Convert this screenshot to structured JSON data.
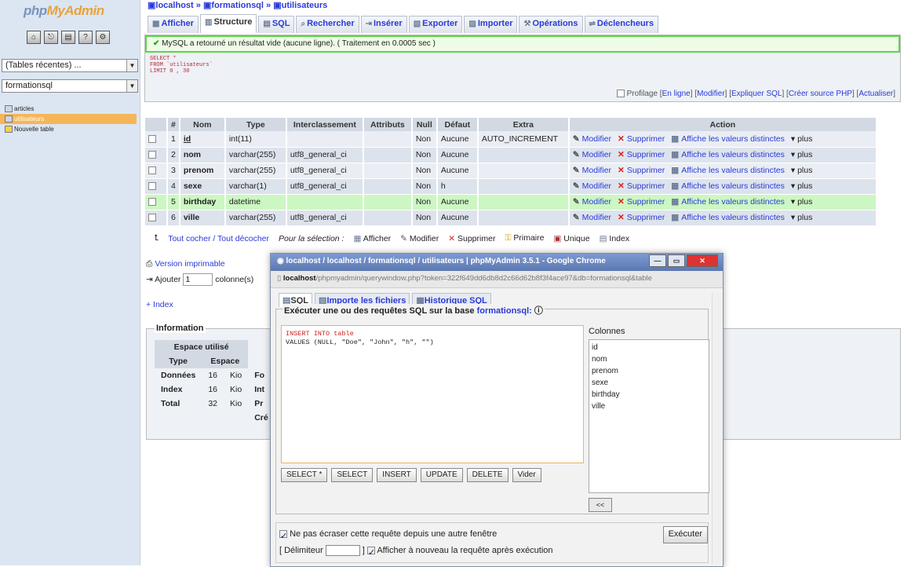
{
  "sidebar": {
    "logo_php": "php",
    "logo_myadmin": "MyAdmin",
    "icons": [
      "home-icon",
      "exit-icon",
      "query-window-icon",
      "docs-icon",
      "config-icon"
    ],
    "recent_tables": "(Tables récentes) ...",
    "database_select": "formationsql",
    "tables": [
      {
        "label": "articles",
        "selected": false
      },
      {
        "label": "utilisateurs",
        "selected": true
      },
      {
        "label": "Nouvelle table",
        "selected": false
      }
    ]
  },
  "breadcrumb": {
    "server": "localhost",
    "database": "formationsql",
    "table": "utilisateurs"
  },
  "tabs": [
    "Afficher",
    "Structure",
    "SQL",
    "Rechercher",
    "Insérer",
    "Exporter",
    "Importer",
    "Opérations",
    "Déclencheurs"
  ],
  "message": {
    "text": "MySQL a retourné un résultat vide (aucune ligne). ( Traitement en 0.0005 sec )",
    "sql_lines": [
      "SELECT *",
      "FROM `utilisateurs`",
      "LIMIT 0 , 30"
    ],
    "profiling_label": "Profilage",
    "links": [
      "En ligne",
      "Modifier",
      "Expliquer SQL",
      "Créer source PHP",
      "Actualiser"
    ]
  },
  "structure": {
    "headers": [
      "#",
      "Nom",
      "Type",
      "Interclassement",
      "Attributs",
      "Null",
      "Défaut",
      "Extra",
      "Action"
    ],
    "rows": [
      {
        "num": "1",
        "name": "id",
        "type": "int(11)",
        "collation": "",
        "attributes": "",
        "null": "Non",
        "default": "Aucune",
        "extra": "AUTO_INCREMENT"
      },
      {
        "num": "2",
        "name": "nom",
        "type": "varchar(255)",
        "collation": "utf8_general_ci",
        "attributes": "",
        "null": "Non",
        "default": "Aucune",
        "extra": ""
      },
      {
        "num": "3",
        "name": "prenom",
        "type": "varchar(255)",
        "collation": "utf8_general_ci",
        "attributes": "",
        "null": "Non",
        "default": "Aucune",
        "extra": ""
      },
      {
        "num": "4",
        "name": "sexe",
        "type": "varchar(1)",
        "collation": "utf8_general_ci",
        "attributes": "",
        "null": "Non",
        "default": "h",
        "extra": ""
      },
      {
        "num": "5",
        "name": "birthday",
        "type": "datetime",
        "collation": "",
        "attributes": "",
        "null": "Non",
        "default": "Aucune",
        "extra": ""
      },
      {
        "num": "6",
        "name": "ville",
        "type": "varchar(255)",
        "collation": "utf8_general_ci",
        "attributes": "",
        "null": "Non",
        "default": "Aucune",
        "extra": ""
      }
    ],
    "actions": {
      "modify": "Modifier",
      "delete": "Supprimer",
      "distinct": "Affiche les valeurs distinctes",
      "more": "plus"
    }
  },
  "bulk": {
    "check_all": "Tout cocher / Tout décocher",
    "with_selected": "Pour la sélection :",
    "actions": [
      "Afficher",
      "Modifier",
      "Supprimer",
      "Primaire",
      "Unique",
      "Index"
    ]
  },
  "below": {
    "print_view": "Version imprimable",
    "add_label": "Ajouter",
    "add_value": "1",
    "columns_label": "colonne(s)",
    "index_link": "+ Index"
  },
  "info": {
    "legend": "Information",
    "space_header": "Espace utilisé",
    "type_header": "Type",
    "space_col_header": "Espace",
    "rows": [
      {
        "type": "Données",
        "space": "16",
        "unit": "Kio"
      },
      {
        "type": "Index",
        "space": "16",
        "unit": "Kio"
      },
      {
        "type": "Total",
        "space": "32",
        "unit": "Kio"
      }
    ],
    "right_labels": [
      "Fo",
      "Int",
      "Pr",
      "Cré"
    ]
  },
  "popup": {
    "title": "localhost / localhost / formationsql / utilisateurs | phpMyAdmin 3.5.1 - Google Chrome",
    "url_host": "localhost",
    "url_rest": "/phpmyadmin/querywindow.php?token=322f649dd6db8d2c66d62b8f3f4ace97&db=formationsql&table",
    "tabs": [
      "SQL",
      "Importe les fichiers",
      "Historique SQL"
    ],
    "legend_prefix": "Exécuter une ou des requêtes SQL sur la base",
    "legend_db": "formationsql:",
    "sql_line1": "INSERT INTO table",
    "sql_line2": "VALUES (NULL, \"Doe\", \"John\", \"h\", \"\")",
    "buttons": [
      "SELECT *",
      "SELECT",
      "INSERT",
      "UPDATE",
      "DELETE",
      "Vider"
    ],
    "columns_title": "Colonnes",
    "columns": [
      "id",
      "nom",
      "prenom",
      "sexe",
      "birthday",
      "ville"
    ],
    "insert_btn": "<<",
    "no_overwrite": "Ne pas écraser cette requête depuis une autre fenêtre",
    "delimiter_label": "[ Délimiteur",
    "show_again": "Afficher à nouveau la requête après exécution",
    "execute": "Exécuter"
  },
  "colors": {
    "link": "#2a3ad8",
    "success": "#5fd34c",
    "sidebar": "#dbe6f2",
    "highlight_row": "#ccf7c2",
    "selected_table": "#f5b65a"
  }
}
